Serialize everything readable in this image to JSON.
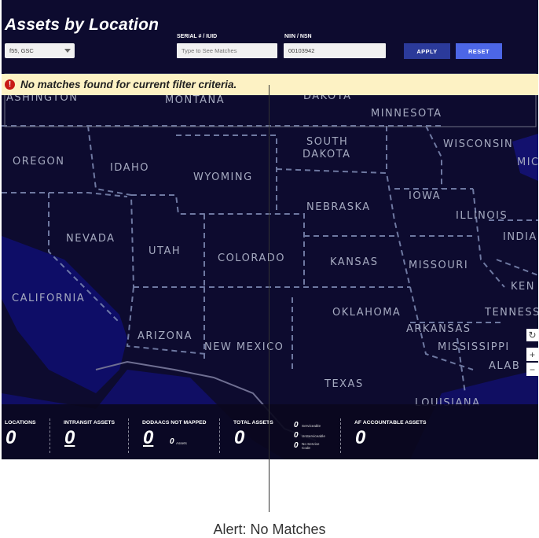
{
  "header": {
    "title": "Assets by Location"
  },
  "filters": {
    "location_select": {
      "value": "f55, GSC"
    },
    "serial": {
      "label": "SERIAL # / IUID",
      "placeholder": "Type to See Matches"
    },
    "niin": {
      "label": "NIIN / NSN",
      "value": "00103942"
    },
    "apply_label": "APPLY",
    "reset_label": "RESET"
  },
  "alert": {
    "message": "No matches found for current filter criteria.",
    "icon": "error-icon",
    "color": "#c81a16"
  },
  "map": {
    "zoom_controls": [
      "refresh-icon",
      "zoom-in-icon",
      "zoom-out-icon"
    ],
    "states": [
      "ASHINGTON",
      "MONTANA",
      "DAKOTA",
      "MINNESOTA",
      "WISCONSIN",
      "MIC",
      "OREGON",
      "IDAHO",
      "WYOMING",
      "SOUTH",
      "DAKOTA",
      "IOWA",
      "ILLINOIS",
      "INDIA",
      "NEBRASKA",
      "NEVADA",
      "UTAH",
      "COLORADO",
      "KANSAS",
      "MISSOURI",
      "KEN",
      "CALIFORNIA",
      "OKLAHOMA",
      "TENNESS",
      "ARKANSAS",
      "ARIZONA",
      "NEW MEXICO",
      "MISSISSIPPI",
      "ALAB",
      "TEXAS",
      "LOUISIANA"
    ]
  },
  "stats": {
    "locations": {
      "label": "LOCATIONS",
      "value": "0"
    },
    "intransit": {
      "label": "INTRANSIT ASSETS",
      "value": "0"
    },
    "dodaacs": {
      "label": "DODAACS NOT MAPPED",
      "value": "0",
      "sub_value": "0",
      "sub_label": "Assets"
    },
    "total": {
      "label": "TOTAL ASSETS",
      "value": "0"
    },
    "breakdown": [
      {
        "value": "0",
        "label": "Serviceable"
      },
      {
        "value": "0",
        "label": "UnServiceable"
      },
      {
        "value": "0",
        "label": "No Service Code"
      }
    ],
    "af_accountable": {
      "label": "AF ACCOUNTABLE ASSETS",
      "value": "0"
    }
  },
  "caption": "Alert: No Matches",
  "colors": {
    "map_bg": "#0c0a2a",
    "land": "#0f0d34",
    "border": "#7f8cb5",
    "apply": "#2b3a9a",
    "reset": "#4c66e6",
    "alert_bg": "#fdf2c4"
  }
}
